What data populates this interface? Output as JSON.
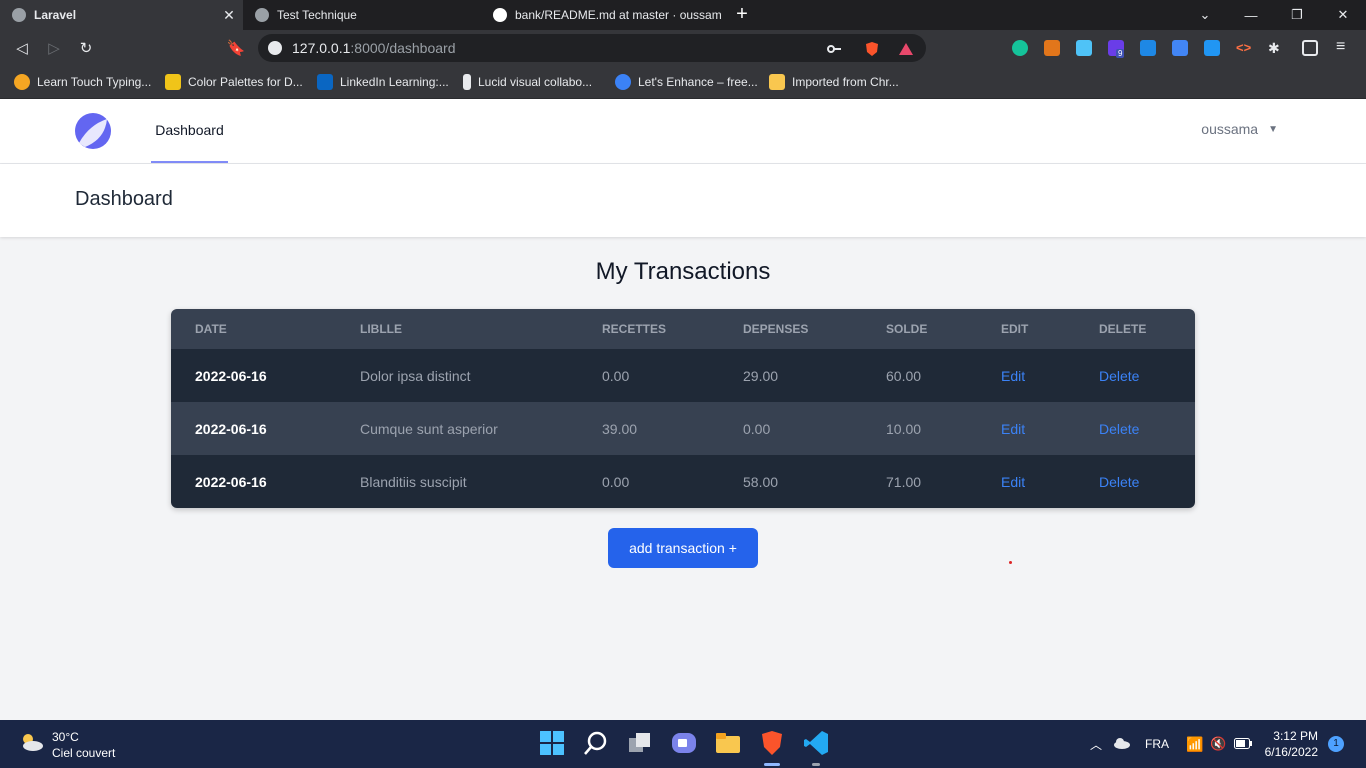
{
  "browser": {
    "tabs": [
      {
        "title": "Laravel",
        "active": true
      },
      {
        "title": "Test Technique",
        "active": false
      },
      {
        "title": "bank/README.md at master · oussama",
        "active": false
      }
    ],
    "url_host": "127.0.0.1",
    "url_path": ":8000/dashboard",
    "extension_badge": "9",
    "bookmarks": [
      "Learn Touch Typing...",
      "Color Palettes for D...",
      "LinkedIn Learning:...",
      "Lucid visual collabo...",
      "Let's Enhance – free...",
      "Imported from Chr..."
    ]
  },
  "app": {
    "nav": {
      "dashboard_link": "Dashboard",
      "user_name": "oussama"
    },
    "page_title": "Dashboard",
    "section_title": "My Transactions",
    "table": {
      "headers": [
        "DATE",
        "LIBLLE",
        "RECETTES",
        "DEPENSES",
        "SOLDE",
        "EDIT",
        "DELETE"
      ],
      "rows": [
        {
          "date": "2022-06-16",
          "libelle": "Dolor ipsa distinct",
          "recettes": "0.00",
          "depenses": "29.00",
          "solde": "60.00",
          "edit": "Edit",
          "delete": "Delete"
        },
        {
          "date": "2022-06-16",
          "libelle": "Cumque sunt asperior",
          "recettes": "39.00",
          "depenses": "0.00",
          "solde": "10.00",
          "edit": "Edit",
          "delete": "Delete"
        },
        {
          "date": "2022-06-16",
          "libelle": "Blanditiis suscipit",
          "recettes": "0.00",
          "depenses": "58.00",
          "solde": "71.00",
          "edit": "Edit",
          "delete": "Delete"
        }
      ]
    },
    "add_button": "add transaction +"
  },
  "taskbar": {
    "weather_temp": "30°C",
    "weather_desc": "Ciel couvert",
    "language": "FRA",
    "time": "3:12 PM",
    "date": "6/16/2022",
    "notifications": "1"
  },
  "colors": {
    "accent": "#2563eb",
    "link": "#3b82f6",
    "table_dark": "#1f2937",
    "table_light": "#374151"
  }
}
